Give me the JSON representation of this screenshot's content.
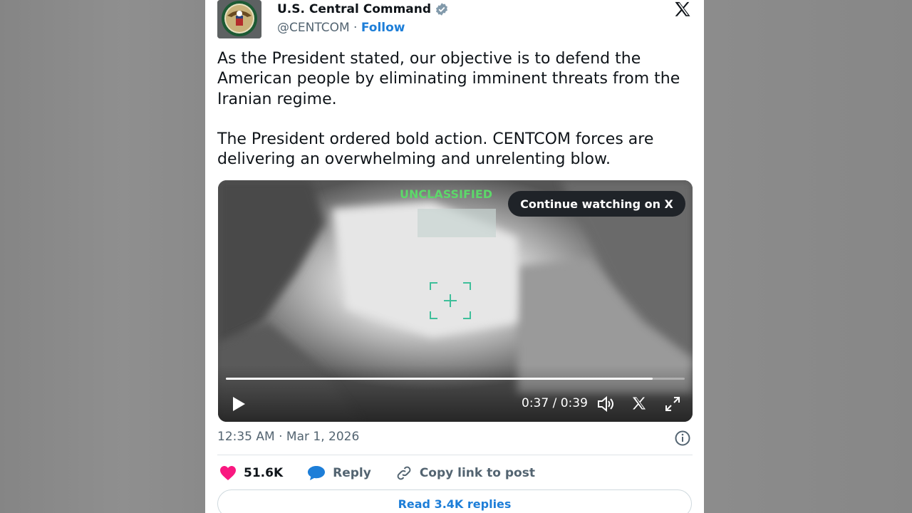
{
  "tweet": {
    "display_name": "U.S. Central Command",
    "verified": true,
    "handle": "@CENTCOM",
    "separator": " · ",
    "follow_label": "Follow",
    "paragraph_1": "As the President stated, our objective is to defend the American people by eliminating imminent threats from the Iranian regime.",
    "paragraph_2": "The President ordered bold action. CENTCOM forces are delivering an overwhelming and unrelenting blow.",
    "timestamp": "12:35 AM · Mar 1, 2026"
  },
  "video": {
    "overlay_text": "UNCLASSIFIED",
    "continue_label": "Continue watching on X",
    "time": "0:37 / 0:39",
    "progress": 0.93
  },
  "actions": {
    "likes": "51.6K",
    "reply_label": "Reply",
    "copy_label": "Copy link to post"
  },
  "read_replies_label": "Read 3.4K replies",
  "colors": {
    "accent": "#1d7ed8",
    "like": "#f91880",
    "verified": "#829aab"
  },
  "icons": {
    "verified": "verified-badge-icon",
    "x_logo": "x-logo-icon",
    "play": "play-icon",
    "volume": "volume-icon",
    "fullscreen": "fullscreen-icon",
    "info": "info-icon",
    "heart": "heart-icon",
    "reply": "reply-bubble-icon",
    "link": "link-icon"
  }
}
